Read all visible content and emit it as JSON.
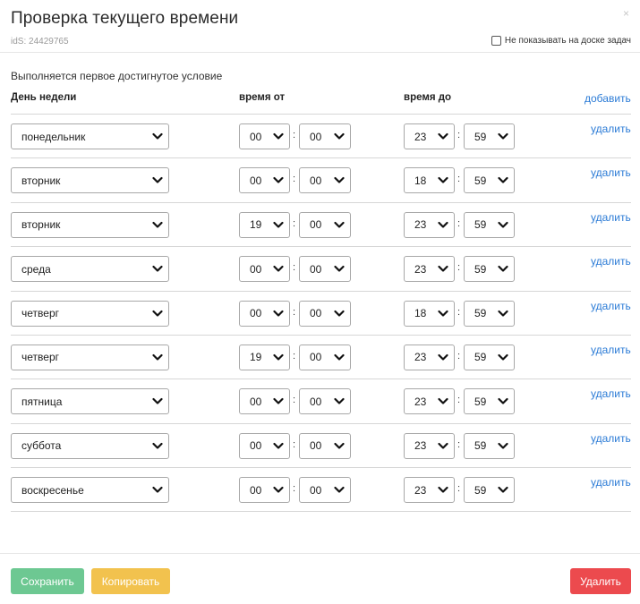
{
  "dialog": {
    "title": "Проверка текущего времени",
    "close_glyph": "×",
    "ids_label": "idS: 24429765",
    "hide_on_board_label": "Не показывать на доске задач",
    "hide_on_board_checked": false
  },
  "condition_note": "Выполняется первое достигнутое условие",
  "columns": {
    "day": "День недели",
    "time_from": "время от",
    "time_to": "время до",
    "add_label": "добавить"
  },
  "rows": [
    {
      "day": "понедельник",
      "from_h": "00",
      "from_m": "00",
      "to_h": "23",
      "to_m": "59",
      "delete_label": "удалить"
    },
    {
      "day": "вторник",
      "from_h": "00",
      "from_m": "00",
      "to_h": "18",
      "to_m": "59",
      "delete_label": "удалить"
    },
    {
      "day": "вторник",
      "from_h": "19",
      "from_m": "00",
      "to_h": "23",
      "to_m": "59",
      "delete_label": "удалить"
    },
    {
      "day": "среда",
      "from_h": "00",
      "from_m": "00",
      "to_h": "23",
      "to_m": "59",
      "delete_label": "удалить"
    },
    {
      "day": "четверг",
      "from_h": "00",
      "from_m": "00",
      "to_h": "18",
      "to_m": "59",
      "delete_label": "удалить"
    },
    {
      "day": "четверг",
      "from_h": "19",
      "from_m": "00",
      "to_h": "23",
      "to_m": "59",
      "delete_label": "удалить"
    },
    {
      "day": "пятница",
      "from_h": "00",
      "from_m": "00",
      "to_h": "23",
      "to_m": "59",
      "delete_label": "удалить"
    },
    {
      "day": "суббота",
      "from_h": "00",
      "from_m": "00",
      "to_h": "23",
      "to_m": "59",
      "delete_label": "удалить"
    },
    {
      "day": "воскресенье",
      "from_h": "00",
      "from_m": "00",
      "to_h": "23",
      "to_m": "59",
      "delete_label": "удалить"
    }
  ],
  "time_separator": ":",
  "footer": {
    "save_label": "Сохранить",
    "copy_label": "Копировать",
    "delete_label": "Удалить"
  },
  "icons": {
    "select_arrow": "chevron-down-icon",
    "close": "close-icon"
  },
  "colors": {
    "link": "#2b7bd6",
    "save": "#6dc892",
    "copy": "#f2c24e",
    "delete": "#ec4a4e"
  }
}
